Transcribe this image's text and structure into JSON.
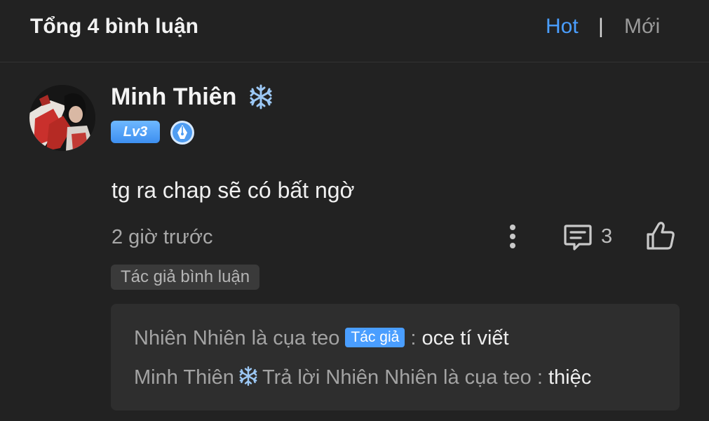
{
  "header": {
    "title": "Tổng 4 bình luận",
    "sort_hot": "Hot",
    "sort_separator": "|",
    "sort_new": "Mới"
  },
  "comment": {
    "username": "Minh Thiên",
    "username_icon": "snowflake-icon",
    "level_badge": "Lv3",
    "writer_badge_icon": "pen-nib-icon",
    "text": "tg ra chap sẽ có bất ngờ",
    "timestamp": "2 giờ trước",
    "reply_count": "3",
    "author_tag": "Tác giả bình luận"
  },
  "replies": [
    {
      "author": "Nhiên Nhiên là cụa teo",
      "author_chip": "Tác giả",
      "separator": " :",
      "content": " oce tí viết"
    },
    {
      "author": "Minh Thiên",
      "reply_to_text": "Trả lời Nhiên Nhiên là cụa teo",
      "separator": " :",
      "content": " thiệc"
    }
  ],
  "colors": {
    "background": "#222222",
    "accent": "#4a9eff",
    "reply_box": "#2e2e2e"
  }
}
